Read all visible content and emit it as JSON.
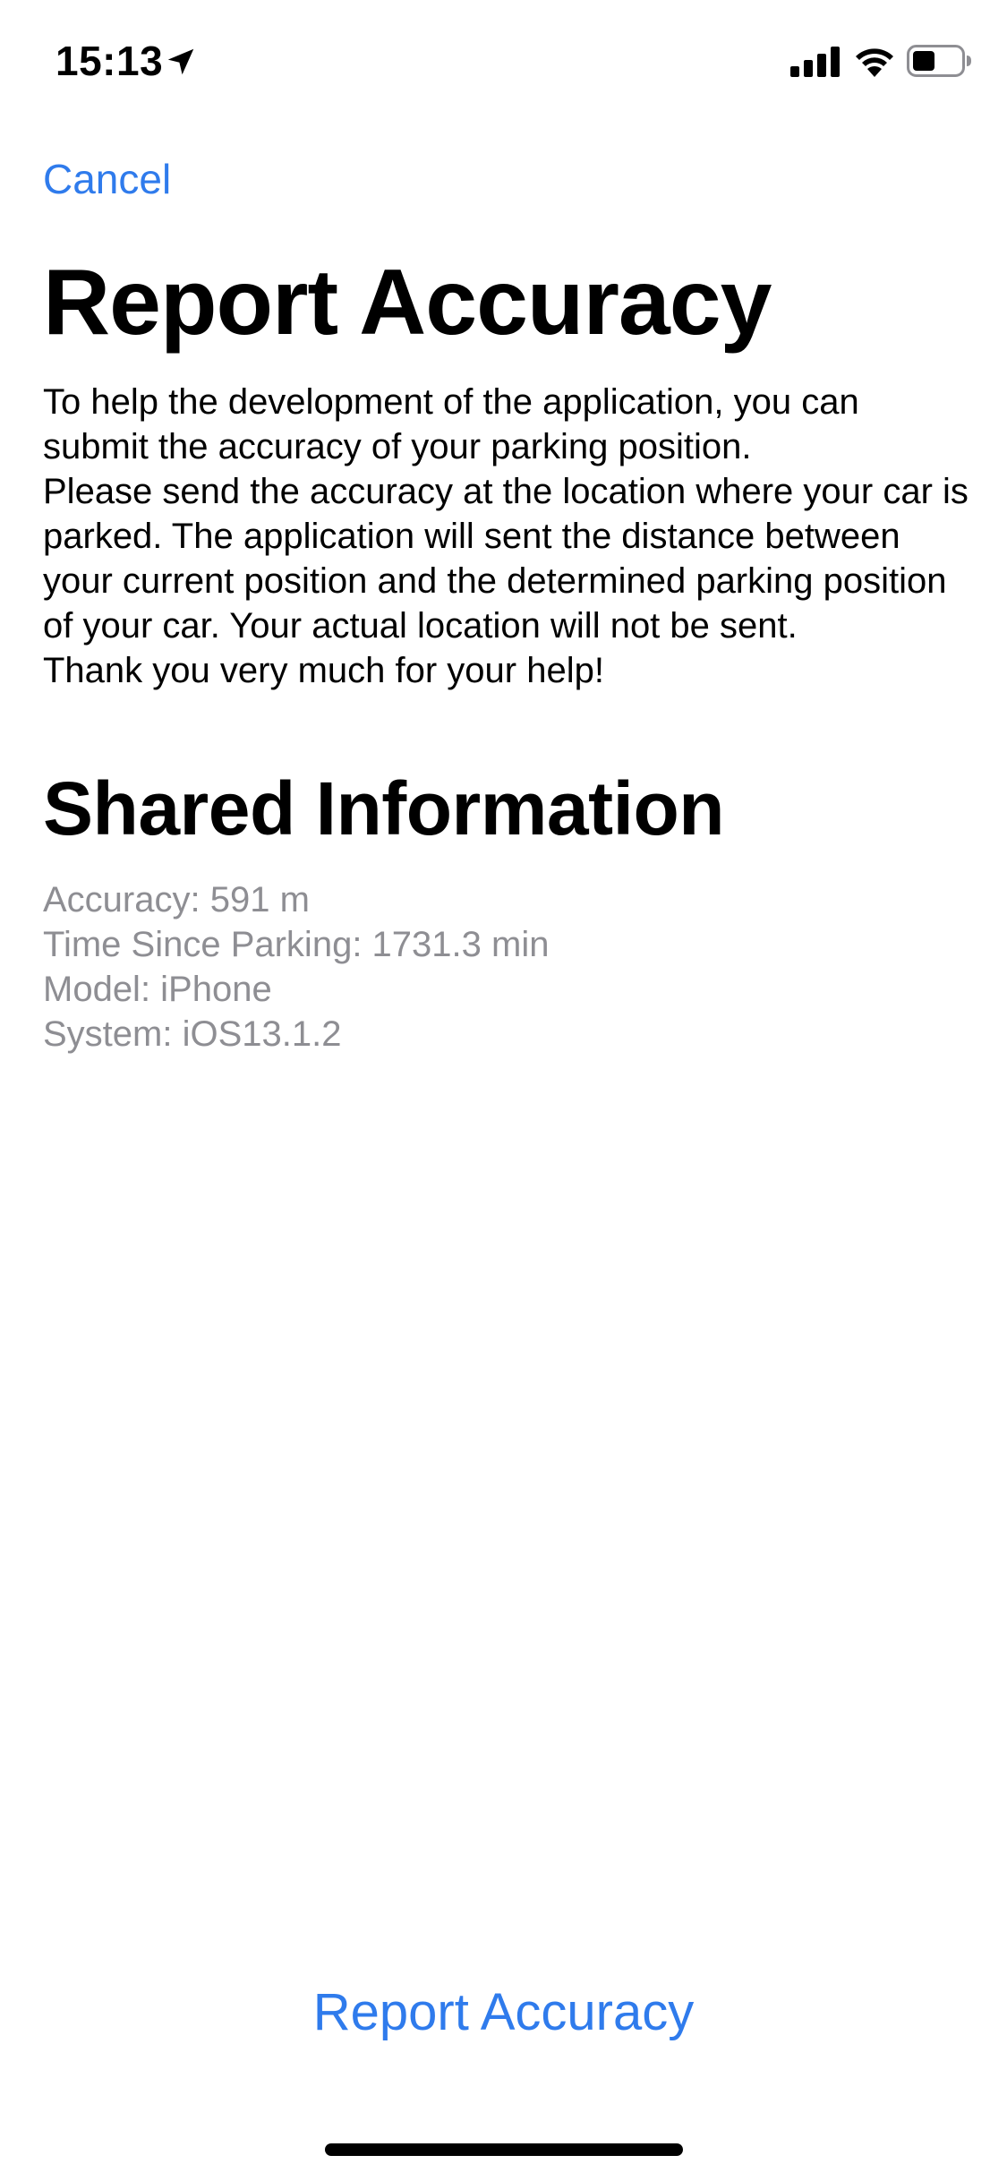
{
  "status_bar": {
    "time": "15:13",
    "icons": [
      "location-arrow-icon",
      "cellular-signal-icon",
      "wifi-icon",
      "battery-icon"
    ]
  },
  "nav": {
    "cancel_label": "Cancel"
  },
  "page": {
    "title": "Report Accuracy",
    "description_lines": [
      "To help the development of the application, you can submit the accuracy of your parking position.",
      "Please send the accuracy at the location where your car is parked. The application will sent the distance between your current position and the determined parking position of your car. Your actual location will not be sent.",
      "Thank you very much for your help!"
    ]
  },
  "shared_information": {
    "title": "Shared Information",
    "items": [
      "Accuracy: 591 m",
      "Time Since Parking: 1731.3 min",
      "Model: iPhone",
      "System: iOS13.1.2"
    ]
  },
  "actions": {
    "report_label": "Report Accuracy"
  },
  "colors": {
    "accent": "#2f7bec",
    "secondary_text": "#8e8e93",
    "background": "#ffffff"
  }
}
